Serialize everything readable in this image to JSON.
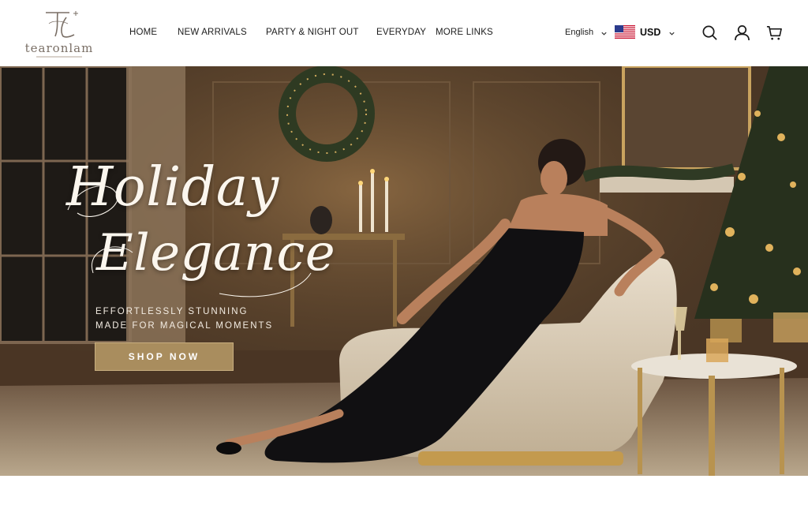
{
  "brand": {
    "monogram": "TL",
    "name": "tearonlam"
  },
  "nav": {
    "items": [
      {
        "label": "HOME"
      },
      {
        "label": "NEW ARRIVALS"
      },
      {
        "label": "PARTY & NIGHT OUT"
      },
      {
        "label": "EVERYDAY"
      },
      {
        "label": "MORE LINKS"
      }
    ]
  },
  "locale": {
    "language": "English",
    "currency": "USD"
  },
  "icons": {
    "search": "search-icon",
    "account": "user-icon",
    "cart": "cart-icon",
    "flag": "us-flag-icon",
    "chevron": "chevron-down-icon"
  },
  "hero": {
    "headline_line1": "Holiday",
    "headline_line2": "Elegance",
    "subtitle_line1": "EFFORTLESSLY STUNNING",
    "subtitle_line2": "MADE FOR MAGICAL MOMENTS",
    "cta_label": "SHOP NOW"
  },
  "colors": {
    "accent_gold": "#a98d5e",
    "header_bg": "#ffffff",
    "text": "#1a1a1a"
  }
}
